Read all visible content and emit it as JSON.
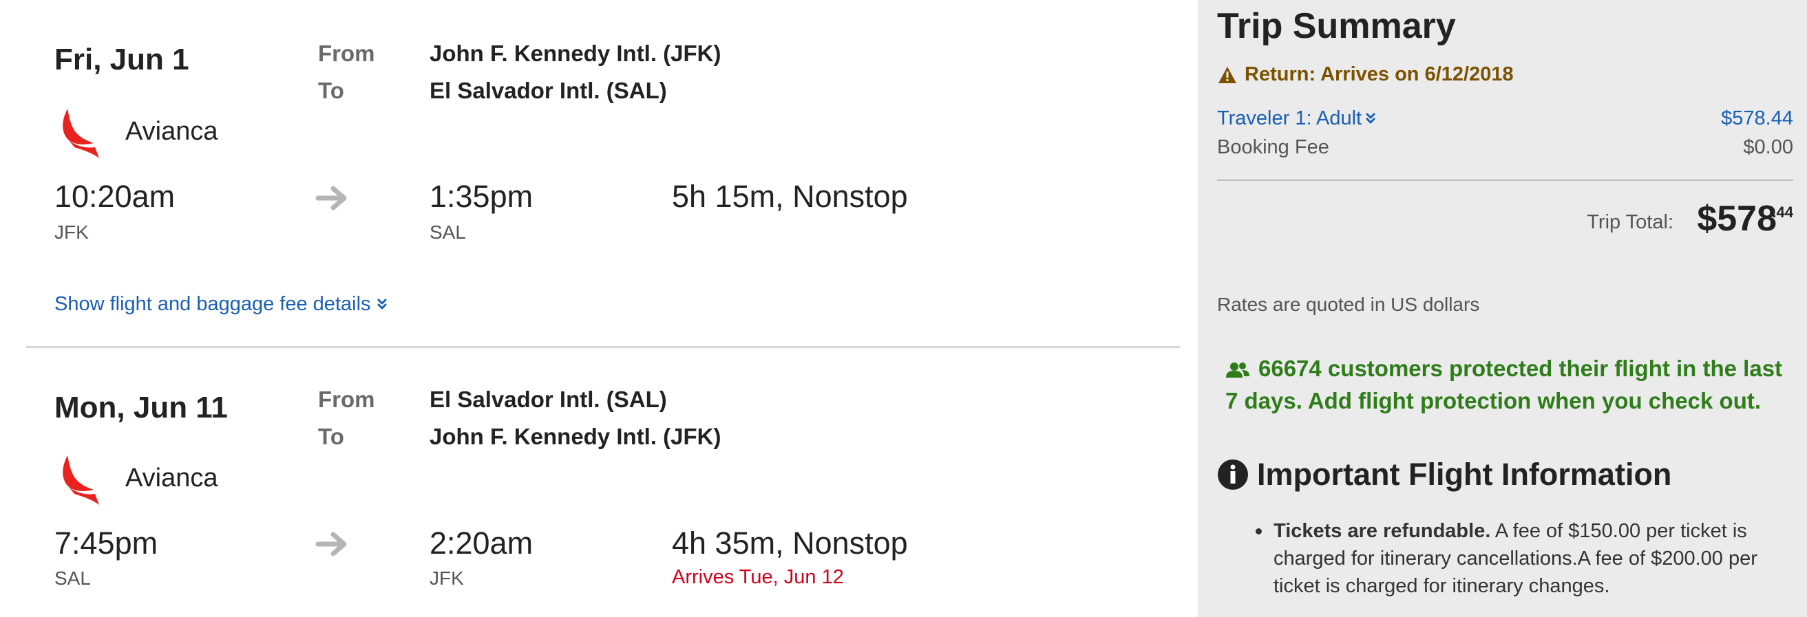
{
  "legs": [
    {
      "date": "Fri, Jun 1",
      "from_label": "From",
      "to_label": "To",
      "from_airport": "John F. Kennedy Intl. (JFK)",
      "to_airport": "El Salvador Intl. (SAL)",
      "airline": "Avianca",
      "depart_time": "10:20am",
      "depart_code": "JFK",
      "arrive_time": "1:35pm",
      "arrive_code": "SAL",
      "duration": "5h 15m, Nonstop",
      "details_link": "Show flight and baggage fee details"
    },
    {
      "date": "Mon, Jun 11",
      "from_label": "From",
      "to_label": "To",
      "from_airport": "El Salvador Intl. (SAL)",
      "to_airport": "John F. Kennedy Intl. (JFK)",
      "airline": "Avianca",
      "depart_time": "7:45pm",
      "depart_code": "SAL",
      "arrive_time": "2:20am",
      "arrive_code": "JFK",
      "duration": "4h 35m, Nonstop",
      "arrival_note": "Arrives Tue, Jun 12"
    }
  ],
  "summary": {
    "title": "Trip Summary",
    "return_warning": "Return: Arrives on 6/12/2018",
    "traveler_label": "Traveler 1: Adult",
    "traveler_price": "$578.44",
    "fee_label": "Booking Fee",
    "fee_value": "$0.00",
    "total_label": "Trip Total:",
    "total_dollars": "$578",
    "total_cents": ".44",
    "rates_note": "Rates are quoted in US dollars",
    "protection_message": "66674 customers protected their flight in the last 7 days. Add flight protection when you check out.",
    "info_heading": "Important Flight Information",
    "policy_bold": "Tickets are refundable.",
    "policy_text": " A fee of $150.00 per ticket is charged for itinerary cancellations.A fee of $200.00 per ticket is charged for itinerary changes."
  },
  "icons": {
    "airline_logo": "avianca-logo",
    "arrow": "arrow-right-icon",
    "warning": "warning-icon",
    "chevron": "double-chevron-down-icon",
    "users": "users-icon",
    "info": "info-icon"
  },
  "colors": {
    "link": "#1a5fb4",
    "warning": "#7a5200",
    "success": "#2e7d1a",
    "alert": "#d0021b",
    "avianca_red": "#e8231f"
  }
}
